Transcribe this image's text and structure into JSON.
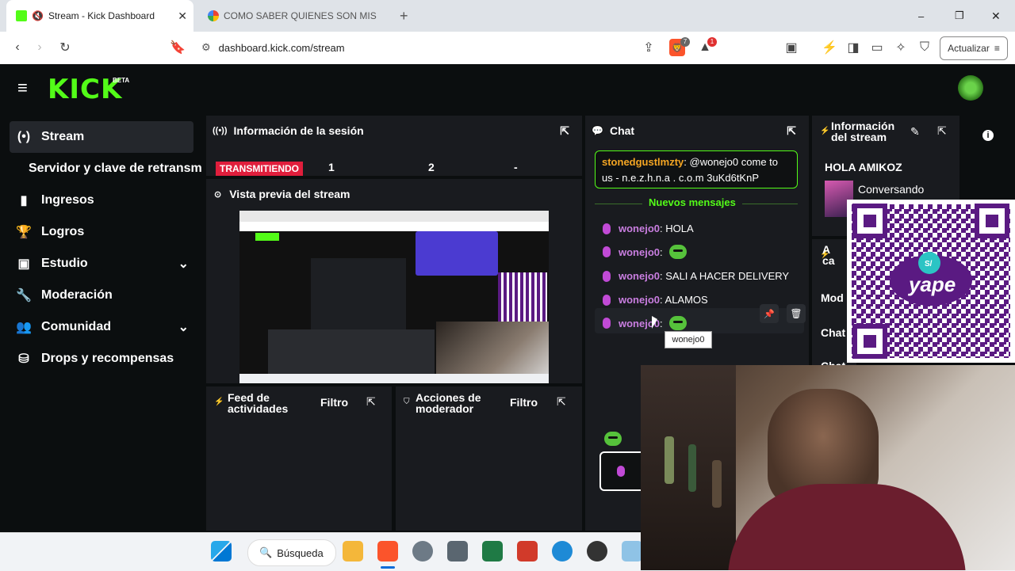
{
  "browser": {
    "tabs": [
      {
        "title": "Stream - Kick Dashboard",
        "active": true
      },
      {
        "title": "COMO SABER QUIENES SON MIS VIE",
        "active": false
      }
    ],
    "new_tab": "+",
    "window_controls": {
      "minimize": "–",
      "maximize": "❐",
      "close": "✕"
    },
    "url": "dashboard.kick.com/stream",
    "update_label": "Actualizar",
    "badge_brave": "7",
    "badge_alert": "1"
  },
  "app": {
    "logo": "KICK",
    "logo_beta": "BETA",
    "brand_color": "#53fc18"
  },
  "sidebar": {
    "items": [
      {
        "label": "Stream",
        "icon": "(•)"
      },
      {
        "label": "Servidor y clave de retransm",
        "icon": ""
      },
      {
        "label": "Ingresos",
        "icon": "▮"
      },
      {
        "label": "Logros",
        "icon": "🏆"
      },
      {
        "label": "Estudio",
        "icon": "▣"
      },
      {
        "label": "Moderación",
        "icon": "🔧"
      },
      {
        "label": "Comunidad",
        "icon": "👥"
      },
      {
        "label": "Drops y recompensas",
        "icon": "⛁"
      }
    ]
  },
  "session": {
    "title": "Información de la sesión",
    "status": "TRANSMITIENDO",
    "stat1": "1",
    "stat2": "2",
    "stat3": "-"
  },
  "preview": {
    "title": "Vista previa del stream"
  },
  "feed": {
    "title_line1": "Feed de",
    "title_line2": "actividades",
    "filter": "Filtro"
  },
  "modactions": {
    "title_line1": "Acciones de",
    "title_line2": "moderador",
    "filter": "Filtro"
  },
  "chat": {
    "title": "Chat",
    "pinned_user": "stonedgustlmzty",
    "pinned_text": ": @wonejo0 come to us - n.e.z.h.n.a . c.o.m 3uKd6tKnP",
    "new_messages": "Nuevos mensajes",
    "messages": [
      {
        "user": "wonejo0",
        "text": ": HOLA",
        "emote": false
      },
      {
        "user": "wonejo0",
        "text": ":",
        "emote": true
      },
      {
        "user": "wonejo0",
        "text": ": SALI A HACER DELIVERY",
        "emote": false
      },
      {
        "user": "wonejo0",
        "text": ": ALAMOS",
        "emote": false
      },
      {
        "user": "wonejo0",
        "text": ":",
        "emote": true
      }
    ],
    "tooltip": "wonejo0"
  },
  "streaminfo": {
    "title_line1": "Información",
    "title_line2": "del stream",
    "stream_title": "HOLA AMIKOZ",
    "category": "Conversando",
    "partial_a": "A",
    "partial_ca": "ca",
    "partial_mod": "Mod",
    "partial_chat1": "Chat",
    "partial_chat2": "Chat"
  },
  "overlay": {
    "qr_label": "yape",
    "qr_badge": "S/"
  },
  "taskbar": {
    "search_label": "Búsqueda"
  }
}
